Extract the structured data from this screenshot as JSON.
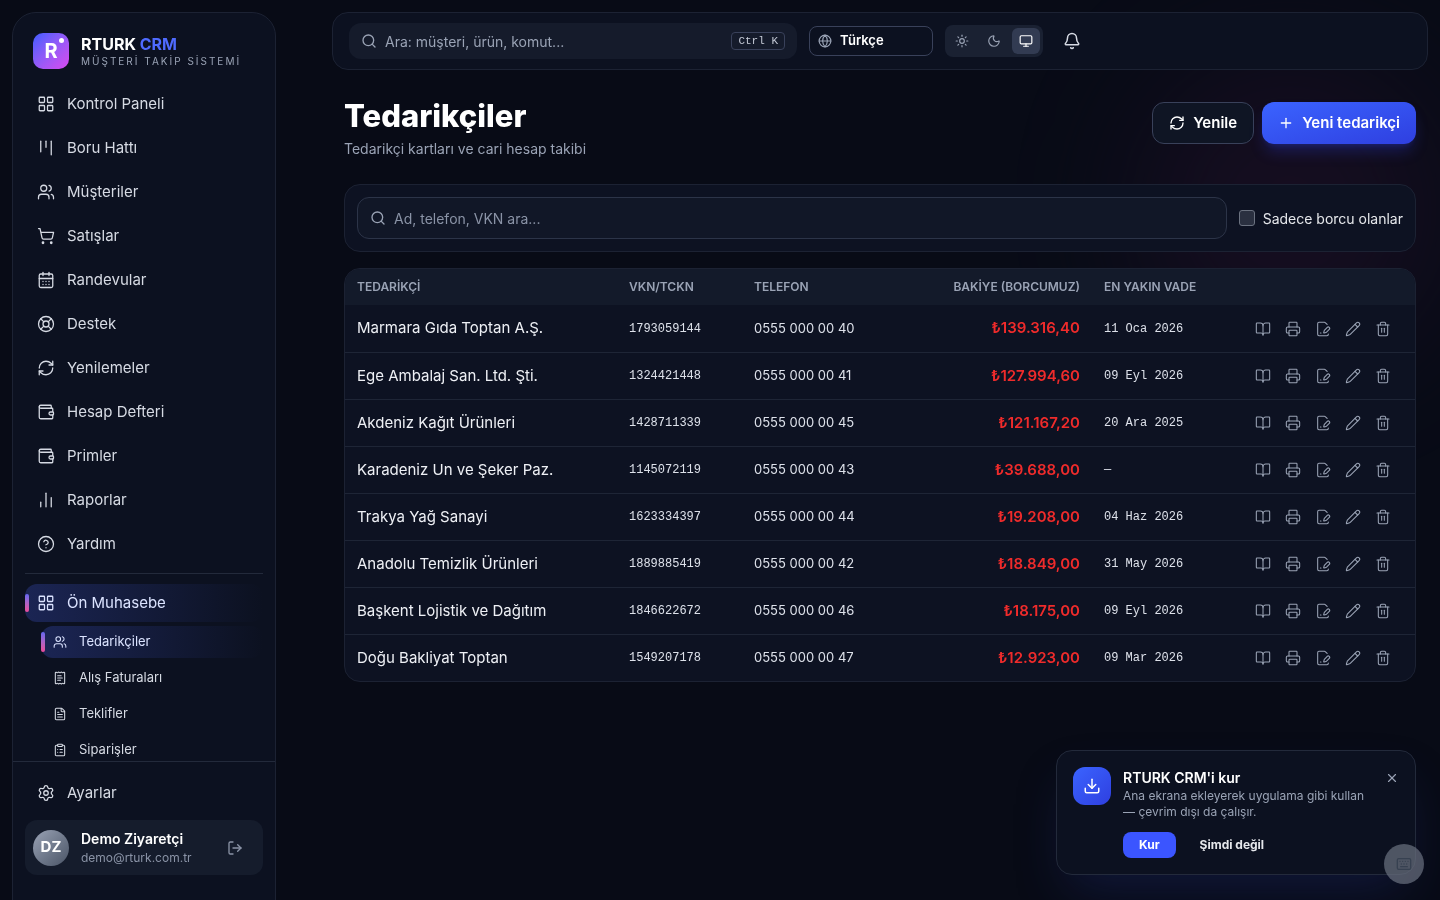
{
  "brand": {
    "mark": "R",
    "name": "RTURK",
    "accent": "CRM",
    "tagline": "MÜŞTERİ TAKİP SİSTEMİ"
  },
  "sidebar": {
    "items": [
      {
        "label": "Kontrol Paneli",
        "selected": false
      },
      {
        "label": "Boru Hattı",
        "selected": false
      },
      {
        "label": "Müşteriler",
        "selected": false
      },
      {
        "label": "Satışlar",
        "selected": false
      },
      {
        "label": "Randevular",
        "selected": false
      },
      {
        "label": "Destek",
        "selected": false
      },
      {
        "label": "Yenilemeler",
        "selected": false
      },
      {
        "label": "Hesap Defteri",
        "selected": false
      },
      {
        "label": "Primler",
        "selected": false
      },
      {
        "label": "Raporlar",
        "selected": false
      },
      {
        "label": "Yardım",
        "selected": false
      },
      {
        "label": "Ön Muhasebe",
        "selected": true,
        "expanded": true,
        "children": [
          {
            "label": "Tedarikçiler",
            "selected": true
          },
          {
            "label": "Alış Faturaları",
            "selected": false
          },
          {
            "label": "Teklifler",
            "selected": false
          },
          {
            "label": "Siparişler",
            "selected": false
          }
        ]
      }
    ],
    "settings": "Ayarlar",
    "user": {
      "initials": "DZ",
      "name": "Demo Ziyaretçi",
      "email": "demo@rturk.com.tr"
    }
  },
  "topbar": {
    "search_placeholder": "Ara: müşteri, ürün, komut...",
    "shortcut": "Ctrl K",
    "language": "Türkçe",
    "themes": [
      {
        "selected": false
      },
      {
        "selected": false
      },
      {
        "selected": true
      }
    ]
  },
  "page": {
    "title": "Tedarikçiler",
    "subtitle": "Tedarikçi kartları ve cari hesap takibi",
    "buttons": [
      "Yenile",
      "Yeni tedarikçi"
    ]
  },
  "filter": {
    "placeholder": "Ad, telefon, VKN ara...",
    "checkbox": {
      "label": "Sadece borcu olanlar",
      "checked": false
    }
  },
  "table": {
    "columns": [
      "TEDARİKÇİ",
      "VKN/TCKN",
      "TELEFON",
      "BAKİYE (BORCUMUZ)",
      "EN YAKIN VADE"
    ],
    "rows": [
      [
        "Marmara Gıda Toptan A.Ş.",
        "1793059144",
        "0555 000 00 40",
        "₺139.316,40",
        "11 Oca 2026"
      ],
      [
        "Ege Ambalaj San. Ltd. Şti.",
        "1324421448",
        "0555 000 00 41",
        "₺127.994,60",
        "09 Eyl 2026"
      ],
      [
        "Akdeniz Kağıt Ürünleri",
        "1428711339",
        "0555 000 00 45",
        "₺121.167,20",
        "20 Ara 2025"
      ],
      [
        "Karadeniz Un ve Şeker Paz.",
        "1145072119",
        "0555 000 00 43",
        "₺39.688,00",
        "—"
      ],
      [
        "Trakya Yağ Sanayi",
        "1623334397",
        "0555 000 00 44",
        "₺19.208,00",
        "04 Haz 2026"
      ],
      [
        "Anadolu Temizlik Ürünleri",
        "1889885419",
        "0555 000 00 42",
        "₺18.849,00",
        "31 May 2026"
      ],
      [
        "Başkent Lojistik ve Dağıtım",
        "1846622672",
        "0555 000 00 46",
        "₺18.175,00",
        "09 Eyl 2026"
      ],
      [
        "Doğu Bakliyat Toptan",
        "1549207178",
        "0555 000 00 47",
        "₺12.923,00",
        "09 Mar 2026"
      ]
    ]
  },
  "toast": {
    "title": "RTURK CRM'i kur",
    "body": "Ana ekrana ekleyerek uygulama gibi kullan — çevrim dışı da çalışır.",
    "primary": "Kur",
    "secondary": "Şimdi değil"
  }
}
